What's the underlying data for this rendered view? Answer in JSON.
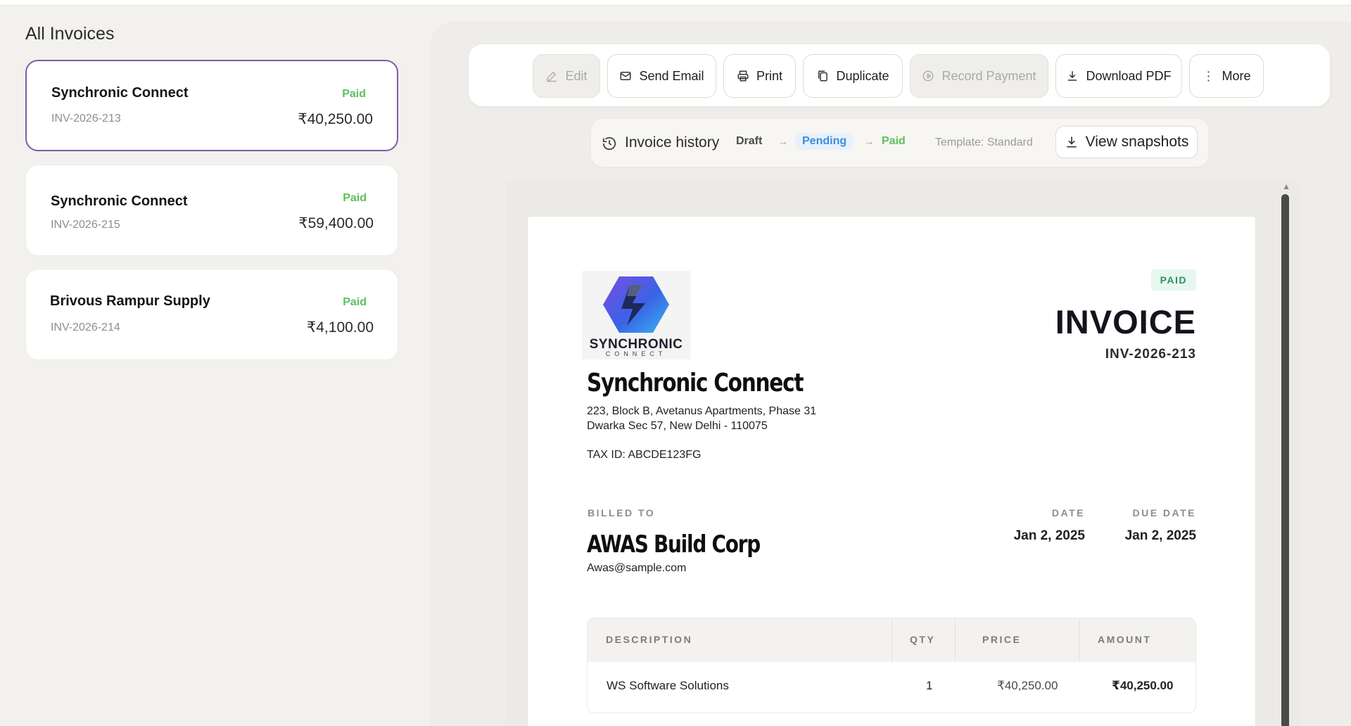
{
  "sidebar": {
    "title": "All Invoices",
    "invoices": [
      {
        "client": "Synchronic Connect",
        "number": "INV-2026-213",
        "status": "Paid",
        "amount": "₹40,250.00"
      },
      {
        "client": "Synchronic Connect",
        "number": "INV-2026-215",
        "status": "Paid",
        "amount": "₹59,400.00"
      },
      {
        "client": "Brivous Rampur Supply",
        "number": "INV-2026-214",
        "status": "Paid",
        "amount": "₹4,100.00"
      }
    ]
  },
  "toolbar": {
    "edit": "Edit",
    "send_email": "Send Email",
    "print": "Print",
    "duplicate": "Duplicate",
    "record_payment": "Record Payment",
    "download_pdf": "Download PDF",
    "more": "More"
  },
  "history": {
    "label": "Invoice history",
    "draft": "Draft",
    "pending": "Pending",
    "paid": "Paid",
    "arrow": "→",
    "template": "Template: Standard",
    "snapshots": "View snapshots"
  },
  "invoice": {
    "logo_word": "SYNCHRONIC",
    "logo_sub": "CONNECT",
    "status_badge": "PAID",
    "title": "INVOICE",
    "number": "INV-2026-213",
    "company": "Synchronic Connect",
    "address_line1": "223, Block B, Avetanus Apartments, Phase 31",
    "address_line2": "Dwarka Sec 57, New Delhi - 110075",
    "tax_id": "TAX ID: ABCDE123FG",
    "billed_to_label": "BILLED TO",
    "billed_to_name": "AWAS Build Corp",
    "billed_to_email": "Awas@sample.com",
    "date_label": "DATE",
    "date": "Jan 2, 2025",
    "due_date_label": "DUE DATE",
    "due_date": "Jan 2, 2025",
    "columns": [
      "DESCRIPTION",
      "QTY",
      "PRICE",
      "AMOUNT"
    ],
    "items": [
      {
        "description": "WS Software Solutions",
        "qty": "1",
        "price": "₹40,250.00",
        "amount": "₹40,250.00"
      }
    ]
  },
  "colors": {
    "accent": "#7a5ea6",
    "paid_green": "#5cc15b",
    "pending_blue": "#3a8ed8"
  }
}
